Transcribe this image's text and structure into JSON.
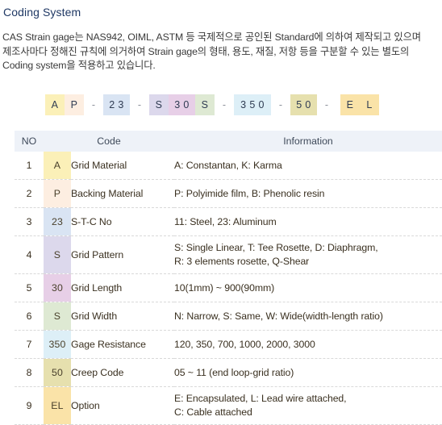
{
  "page": {
    "title": "Coding System",
    "intro_lines": [
      "CAS Strain gage는 NAS942, OIML, ASTM 등 국제적으로 공인된 Standard에 의하여 제작되고 있으며",
      "제조사마다 정해진 규칙에 의거하여 Strain gage의 형태, 용도, 재질, 저항 등을 구분할 수 있는 별도의",
      "Coding system을 적용하고 있습니다."
    ]
  },
  "code_strip": [
    {
      "kind": "chip",
      "text": "A",
      "color": "#fbf0b8",
      "width": "w1"
    },
    {
      "kind": "chip",
      "text": "P",
      "color": "#fdeee1",
      "width": "w1"
    },
    {
      "kind": "dash",
      "text": "-"
    },
    {
      "kind": "chip",
      "text": "2 3",
      "color": "#d9e4f3",
      "width": "w2"
    },
    {
      "kind": "dash",
      "text": "-"
    },
    {
      "kind": "chip",
      "text": "S",
      "color": "#dcd8ec",
      "width": "w1"
    },
    {
      "kind": "chip",
      "text": "3 0",
      "color": "#e7cfe7",
      "width": "w2"
    },
    {
      "kind": "chip",
      "text": "S",
      "color": "#dee9d3",
      "width": "w1"
    },
    {
      "kind": "dash",
      "text": "-"
    },
    {
      "kind": "chip",
      "text": "3 5 0",
      "color": "#ddeff7",
      "width": "w3"
    },
    {
      "kind": "dash",
      "text": "-"
    },
    {
      "kind": "chip",
      "text": "5 0",
      "color": "#e6e0ae",
      "width": "w2"
    },
    {
      "kind": "dash",
      "text": "-"
    },
    {
      "kind": "gap"
    },
    {
      "kind": "chip",
      "text": "E",
      "color": "#fae3a8",
      "width": "w1"
    },
    {
      "kind": "chip",
      "text": "L",
      "color": "#fae3a8",
      "width": "w1"
    }
  ],
  "table": {
    "headers": {
      "no": "NO",
      "code": "Code",
      "information": "Information"
    },
    "rows": [
      {
        "no": "1",
        "code": "A",
        "code_color": "#fbf0b8",
        "name": "Grid Material",
        "info": [
          "A: Constantan, K: Karma"
        ]
      },
      {
        "no": "2",
        "code": "P",
        "code_color": "#fdeee1",
        "name": "Backing Material",
        "info": [
          "P: Polyimide film, B: Phenolic resin"
        ]
      },
      {
        "no": "3",
        "code": "23",
        "code_color": "#d9e4f3",
        "name": "S-T-C No",
        "info": [
          "11: Steel,  23: Aluminum"
        ]
      },
      {
        "no": "4",
        "code": "S",
        "code_color": "#dcd8ec",
        "name": "Grid Pattern",
        "info": [
          "S: Single Linear,   T: Tee Rosette,  D: Diaphragm,",
          "R: 3 elements rosette, Q-Shear"
        ]
      },
      {
        "no": "5",
        "code": "30",
        "code_color": "#e7cfe7",
        "name": "Grid Length",
        "info": [
          "10(1mm) ~ 900(90mm)"
        ]
      },
      {
        "no": "6",
        "code": "S",
        "code_color": "#dee9d3",
        "name": "Grid Width",
        "info": [
          "N: Narrow, S: Same,  W: Wide(width-length ratio)"
        ]
      },
      {
        "no": "7",
        "code": "350",
        "code_color": "#ddeff7",
        "name": "Gage Resistance",
        "info": [
          "120, 350, 700, 1000, 2000, 3000"
        ]
      },
      {
        "no": "8",
        "code": "50",
        "code_color": "#e6e0ae",
        "name": "Creep Code",
        "info": [
          "05 ~ 11 (end loop-grid ratio)"
        ]
      },
      {
        "no": "9",
        "code": "EL",
        "code_color": "#fae3a8",
        "name": "Option",
        "info": [
          "E: Encapsulated, L: Lead wire attached,",
          "C: Cable attached"
        ]
      }
    ]
  },
  "colors": {
    "title": "#1f3864",
    "body_text": "#3a3a3a",
    "table_text": "#3a3020",
    "header_bg": "#eef2f8",
    "row_divider": "#d9d9d9"
  }
}
